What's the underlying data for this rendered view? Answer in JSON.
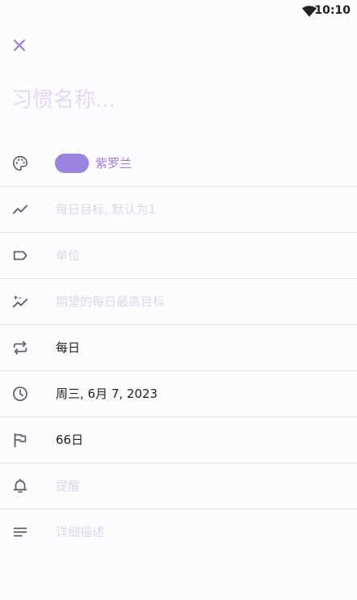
{
  "status_bar": {
    "time": "10:10",
    "icons": [
      "wifi-icon"
    ]
  },
  "header": {
    "close_icon": "close-icon"
  },
  "habit_name": {
    "placeholder": "习惯名称...",
    "value": ""
  },
  "colors": {
    "accent": "#9b7fdc",
    "swatch": "#9b84dd",
    "icon": "#5f5f66",
    "placeholder": "#ded9e4",
    "title_placeholder": "#e4d9f3",
    "divider": "#e9e6ed"
  },
  "rows": {
    "color": {
      "icon": "palette-icon",
      "label": "紫罗兰"
    },
    "daily_goal": {
      "icon": "trending-up-icon",
      "placeholder": "每日目标, 默认为1"
    },
    "unit": {
      "icon": "label-tag-icon",
      "placeholder": "单位"
    },
    "max_goal": {
      "icon": "sparkle-trend-icon",
      "placeholder": "期望的每日最高目标"
    },
    "repeat": {
      "icon": "repeat-icon",
      "value": "每日"
    },
    "start_date": {
      "icon": "clock-icon",
      "value": "周三, 6月 7, 2023"
    },
    "target_days": {
      "icon": "flag-icon",
      "value": "66日"
    },
    "reminder": {
      "icon": "bell-icon",
      "placeholder": "提醒"
    },
    "description": {
      "icon": "notes-icon",
      "placeholder": "详细描述"
    }
  }
}
